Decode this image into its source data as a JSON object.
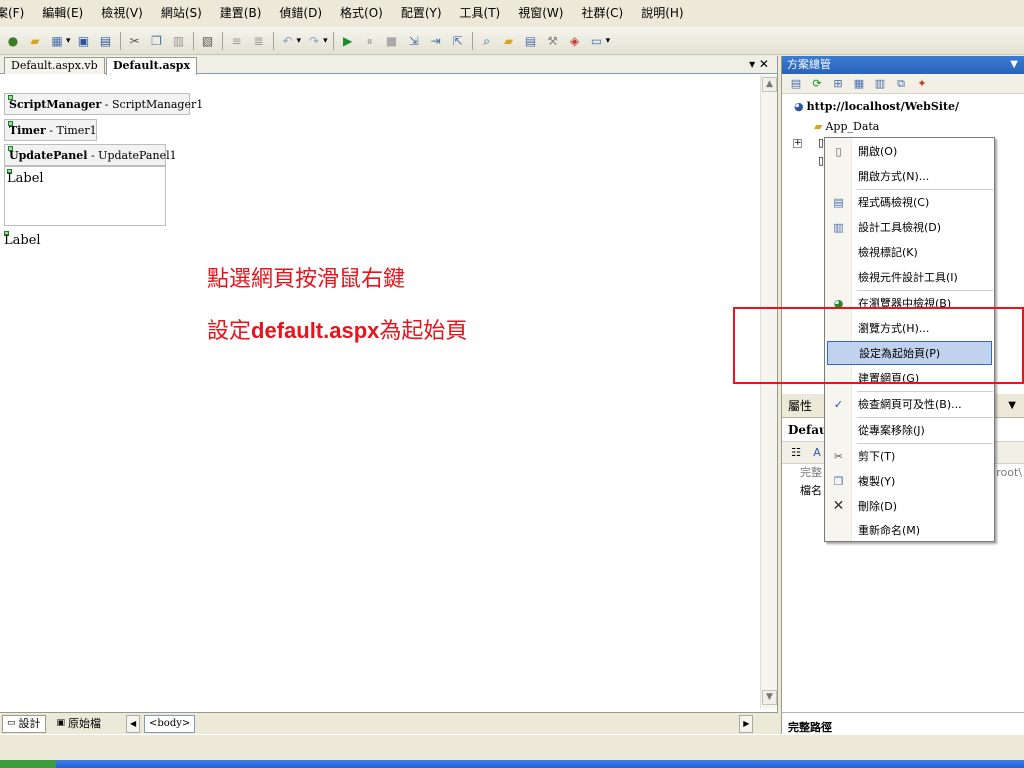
{
  "menubar": {
    "items": [
      "案(F)",
      "編輯(E)",
      "檢視(V)",
      "網站(S)",
      "建置(B)",
      "偵錯(D)",
      "格式(O)",
      "配置(Y)",
      "工具(T)",
      "視窗(W)",
      "社群(C)",
      "說明(H)"
    ]
  },
  "doc_tabs": {
    "tab1": "Default.aspx.vb",
    "tab2": "Default.aspx",
    "controls_glyph": "▾ ✕"
  },
  "design": {
    "script_manager_bold": "ScriptManager",
    "script_manager_rest": " - ScriptManager1",
    "timer_bold": "Timer",
    "timer_rest": " - Timer1",
    "update_panel_bold": "UpdatePanel",
    "update_panel_rest": " - UpdatePanel1",
    "label_inside": "Label",
    "label_outside": "Label"
  },
  "annotation": {
    "line1": "點選網頁按滑鼠右鍵",
    "line2_prefix": "設定",
    "line2_bold": "default.aspx",
    "line2_suffix": "為起始頁"
  },
  "view_bar": {
    "design_tab": "設計",
    "source_tab": "原始檔",
    "tag": "<body>"
  },
  "solution_explorer": {
    "title": "方案總管",
    "root": "http://localhost/WebSite/",
    "node_app_data": "App_Data"
  },
  "context_menu": {
    "items": [
      {
        "label": "開啟(O)",
        "icon": "open-icon"
      },
      {
        "label": "開啟方式(N)...",
        "icon": ""
      },
      {
        "label": "程式碼檢視(C)",
        "icon": "code-view-icon"
      },
      {
        "label": "設計工具檢視(D)",
        "icon": "designer-view-icon"
      },
      {
        "label": "檢視標記(K)",
        "icon": ""
      },
      {
        "label": "檢視元件設計工具(I)",
        "icon": ""
      },
      {
        "label": "在瀏覽器中檢視(B)",
        "icon": "browser-icon"
      },
      {
        "label": "瀏覽方式(H)...",
        "icon": ""
      },
      {
        "label": "設定為起始頁(P)",
        "icon": ""
      },
      {
        "label": "建置網頁(G)",
        "icon": ""
      },
      {
        "label": "檢查網頁可及性(B)...",
        "icon": "accessibility-icon"
      },
      {
        "label": "從專案移除(J)",
        "icon": ""
      },
      {
        "label": "剪下(T)",
        "icon": "cut-icon"
      },
      {
        "label": "複製(Y)",
        "icon": "copy-icon"
      },
      {
        "label": "刪除(D)",
        "icon": "delete-icon"
      },
      {
        "label": "重新命名(M)",
        "icon": ""
      }
    ],
    "highlighted_index": 8
  },
  "properties": {
    "title": "屬性",
    "object": "Defau",
    "row1_name": "完整",
    "row1_value": "root\\",
    "row2_name": "檔名"
  },
  "footer": {
    "description_title": "完整路徑"
  },
  "colors": {
    "annotation_red": "#e8131b",
    "highlight_bg": "#c1d2ee",
    "highlight_border": "#316ac5",
    "panel_title_blue": "#2a63b8"
  }
}
